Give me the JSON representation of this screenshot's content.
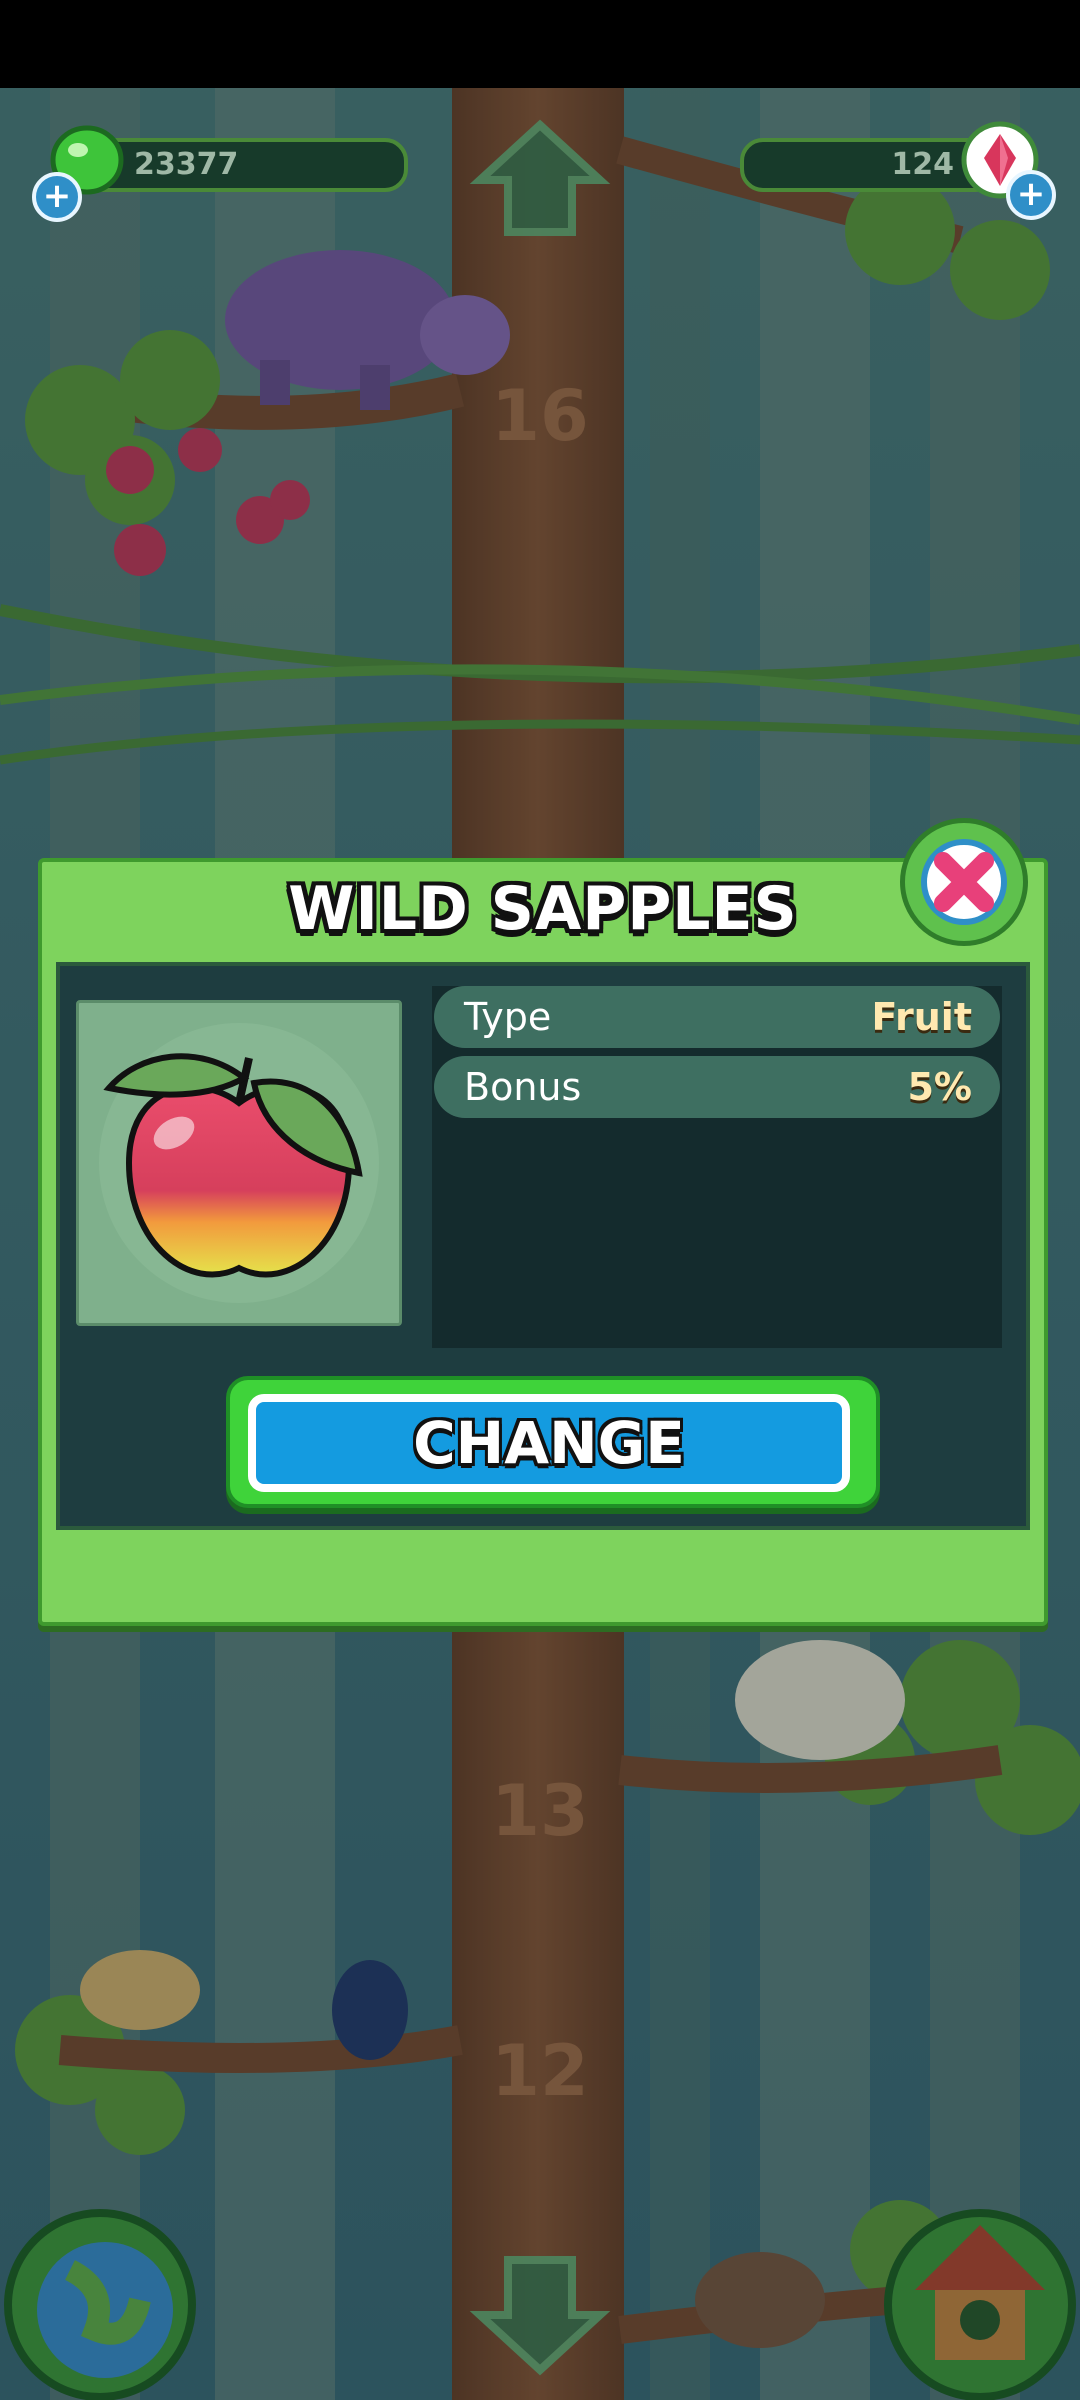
{
  "hud": {
    "coins_value": "23377",
    "gems_value": "124",
    "add_symbol": "+"
  },
  "modal": {
    "title": "WILD SAPPLES",
    "stats": [
      {
        "label": "Type",
        "value": "Fruit"
      },
      {
        "label": "Bonus",
        "value": "5%"
      }
    ],
    "change_label": "CHANGE"
  },
  "tree_floor_numbers": [
    "16",
    "13",
    "12"
  ],
  "colors": {
    "modal_green": "#7ed35d",
    "panel_dark": "#1e3d40",
    "button_blue": "#149be0",
    "close_pink": "#e8407a"
  },
  "icons": {
    "item": "apple-fruit-icon",
    "close": "close-x-icon",
    "world": "globe-icon",
    "home": "house-icon",
    "up": "arrow-up-icon",
    "down": "arrow-down-icon",
    "coins": "green-gem-icon",
    "gems": "red-crystal-icon"
  }
}
